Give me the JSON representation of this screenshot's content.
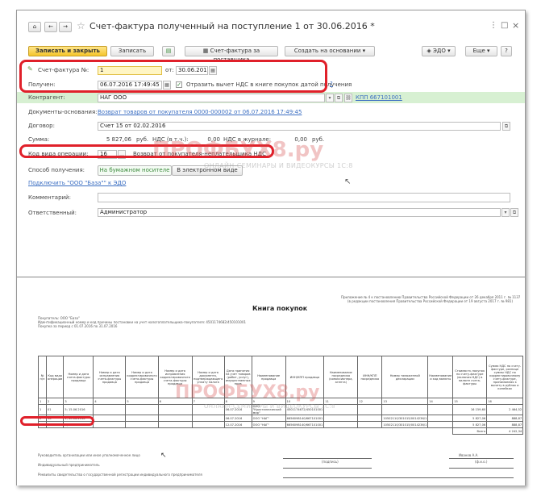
{
  "window": {
    "title": "Счет-фактура полученный на поступление 1 от 30.06.2016 *",
    "nav_icon": "home-icon",
    "star_icon": "star-icon",
    "more_icon": "more-vertical-icon",
    "close_icon": "close-icon"
  },
  "toolbar": {
    "save_close": "Записать и закрыть",
    "save": "Записать",
    "supplier_invoice": "Счет-фактура за поставщика",
    "create_based": "Создать на основании",
    "edo": "ЭДО",
    "more": "Еще",
    "help": "?"
  },
  "form": {
    "invoice_label": "Счет-фактура №:",
    "invoice_number": "1",
    "from_label": "от:",
    "invoice_date": "30.06.2016",
    "received_label": "Получен:",
    "received_date": "06.07.2016 17:49:45",
    "reflect_label": "Отразить вычет НДС в книге покупок датой получения",
    "reflect_checked": "✓",
    "counterparty_label": "Контрагент:",
    "counterparty_value": "НАГ ООО",
    "kpp_link": "КПП 667101001",
    "base_docs_label": "Документы-основания:",
    "base_docs_link": "Возврат товаров от покупателя 0000-000002 от 06.07.2016 17:49:45",
    "contract_label": "Договор:",
    "contract_value": "Счет 15 от 02.02.2016",
    "sum_label": "Сумма:",
    "sum_value": "5 827,06",
    "sum_currency": "руб.",
    "vat_label": "НДС (в т.ч.):",
    "vat_journal": "НДС в журнале:",
    "vat_zero1": "0,00",
    "vat_zero2": "0,00",
    "vat_currency": "руб.",
    "op_code_label": "Код вида операции:",
    "op_code_value": "16",
    "op_code_desc": "Возврат от покупателя-неплательщика НДС",
    "method_label": "Способ получения:",
    "method_paper": "На бумажном носителе",
    "method_electronic": "В электронном виде",
    "connect_link": "Подключить \"ООО \"База\"\" к ЭДО",
    "comment_label": "Комментарий:",
    "responsible_label": "Ответственный:",
    "responsible_value": "Администратор"
  },
  "report": {
    "header_note": "Приложение № 4 к постановлению Правительства Российской Федерации от 26 декабря 2011 г. № 1137",
    "header_note2": "(в редакции постановления Правительства Российской Федерации от 19 августа 2017 г. № 981)",
    "title": "Книга покупок",
    "buyer": "Покупатель: ООО \"База\"",
    "inn_line": "Идентификационный номер и код причины постановки на учет налогоплательщика-покупателя: 4501174682/450101001",
    "period": "Покупка за период с 01.07.2016 по 31.07.2016",
    "columns": [
      "№ п/п",
      "Код вида операции",
      "Номер и дата счета-фактуры продавца",
      "Номер и дата исправления счета-фактуры продавца",
      "Номер и дата корректировочного счета-фактуры продавца",
      "Номер и дата исправления корректировочного счета-фактуры продавца",
      "Номер и дата документа, подтверждающего уплату налога",
      "Дата принятия на учет товаров (работ, услуг), имущественных прав",
      "Наименование продавца",
      "ИНН/КПП продавца",
      "Наименование посредника (комиссионера, агента)",
      "ИНН/КПП посредника",
      "Номер таможенной декларации",
      "Наименование и код валюты",
      "Стоимость покупок по счету-фактуре (включая НДС) в валюте счета-фактуры",
      "Сумма НДС по счету-фактуре, разнице суммы НДС по корректировочному счету-фактуре, принимаемая к вычету в рублях и копейках"
    ],
    "col_numbers": [
      "1",
      "2",
      "3",
      "4",
      "5",
      "6",
      "7",
      "8",
      "9",
      "10",
      "11",
      "12",
      "13",
      "14",
      "15",
      "16"
    ],
    "rows": [
      {
        "n": "1",
        "code": "01",
        "invoice": "5; 15.06.2016",
        "date": "06.07.2016",
        "seller": "ООО \"Кристаллический мир\"",
        "inn": "4501174672/450101001",
        "decl": "",
        "cost": "16 159,60",
        "vat": "2 464,52"
      },
      {
        "n": "2",
        "code": "16",
        "invoice": "1; 30.06.2016",
        "date": "06.07.2016",
        "seller": "ООО \"НАГ\"",
        "inn": "6656098140/667101001",
        "decl": "10502110/301015/0014236/1",
        "cost": "5 827,06",
        "vat": "888,87"
      },
      {
        "n": "3",
        "code": "01",
        "invoice": "1; 12.07.2016",
        "date": "12.07.2016",
        "seller": "ООО \"НАГ\"",
        "inn": "6656098140/667101001",
        "decl": "10502110/301015/0014236/1",
        "cost": "5 827,06",
        "vat": "888,87"
      }
    ],
    "total_label": "Всего",
    "total_value": "4 242,34",
    "sig1": "Руководитель организации или иное уполномоченное лицо",
    "sig2": "Индивидуальный предприниматель",
    "sig3": "Реквизиты свидетельства о государственной регистрации индивидуального предпринимателя",
    "signer": "Иванов А.А.",
    "sig_sub1": "(подпись)",
    "sig_sub2": "(ф.и.о.)"
  },
  "watermark": {
    "brand": "ПРОФБУХ8.ру",
    "subtitle": "ОНЛАЙН-СЕМИНАРЫ И ВИДЕОКУРСЫ 1С:8"
  },
  "colors": {
    "highlight": "#e0202a",
    "primary_button": "#f5c52b",
    "link": "#3b6ec2",
    "counterparty_bg": "#d7f0d2"
  }
}
